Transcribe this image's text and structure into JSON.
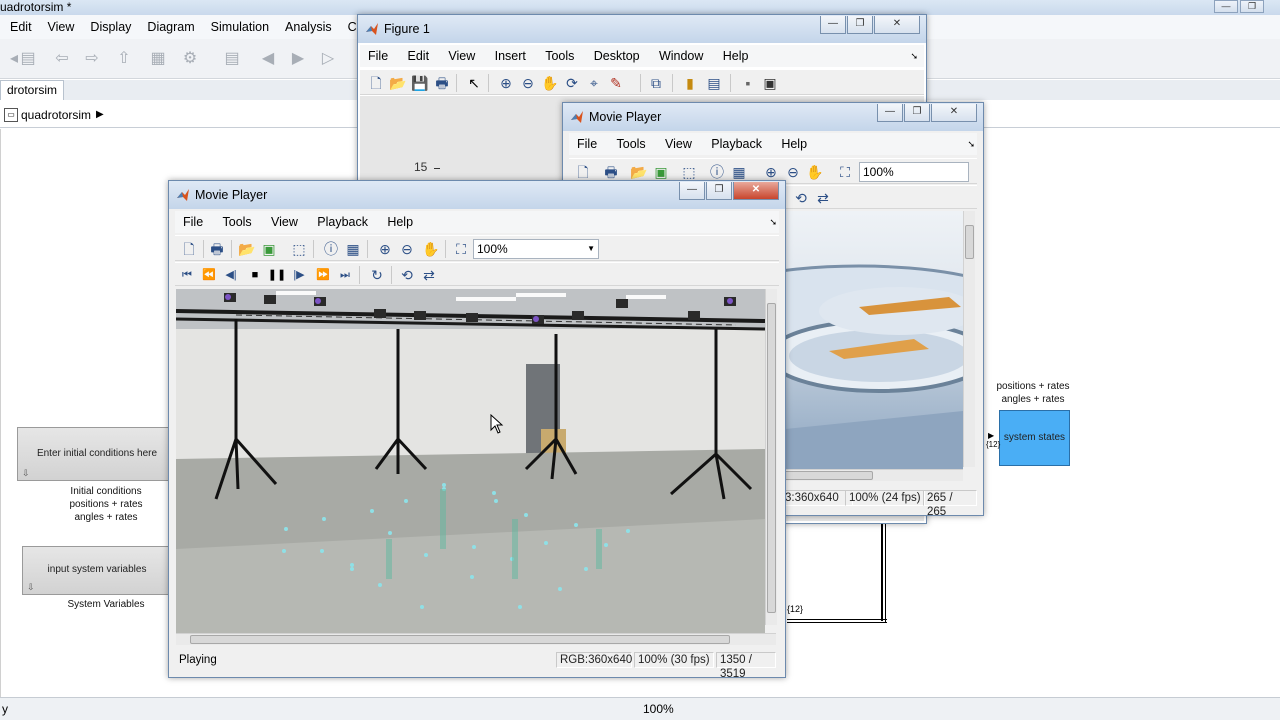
{
  "simulink": {
    "title": "uadrotorsim *",
    "menu": [
      "Edit",
      "View",
      "Display",
      "Diagram",
      "Simulation",
      "Analysis",
      "Cod"
    ],
    "tab_label": "drotorsim",
    "breadcrumb": "quadrotorsim",
    "blocks": {
      "initial_conditions_text": "Enter initial conditions here",
      "initial_conditions_caption": [
        "Initial conditions",
        "positions + rates",
        "angles + rates"
      ],
      "system_vars_text": "input system variables",
      "system_vars_caption": "System Variables",
      "system_states_text": "system states",
      "system_states_caption": [
        "positions + rates",
        "angles + rates"
      ],
      "bus_label": "{12}",
      "port_label": "{12}"
    },
    "status_left": "y",
    "status_zoom": "100%",
    "colors": {
      "system_states_block": "#4aaef5"
    }
  },
  "figure1": {
    "title": "Figure 1",
    "menu": [
      "File",
      "Edit",
      "View",
      "Insert",
      "Tools",
      "Desktop",
      "Window",
      "Help"
    ],
    "axis_tick": "15"
  },
  "movie_back": {
    "title": "Movie Player",
    "menu": [
      "File",
      "Tools",
      "View",
      "Playback",
      "Help"
    ],
    "zoom": "100%",
    "status": {
      "resolution": "3:360x640",
      "zoom_fps": "100% (24 fps)",
      "frame": "265 / 265"
    }
  },
  "movie_front": {
    "title": "Movie Player",
    "menu": [
      "File",
      "Tools",
      "View",
      "Playback",
      "Help"
    ],
    "zoom": "100%",
    "status": {
      "state": "Playing",
      "resolution": "RGB:360x640",
      "zoom_fps": "100% (30 fps)",
      "frame": "1350 / 3519"
    }
  },
  "icons": {
    "playback": [
      "first-frame-icon",
      "rewind-icon",
      "step-back-icon",
      "stop-icon",
      "pause-icon",
      "step-forward-icon",
      "fast-forward-icon",
      "last-frame-icon",
      "loop-icon",
      "forward-backward-icon",
      "swap-icon"
    ]
  }
}
